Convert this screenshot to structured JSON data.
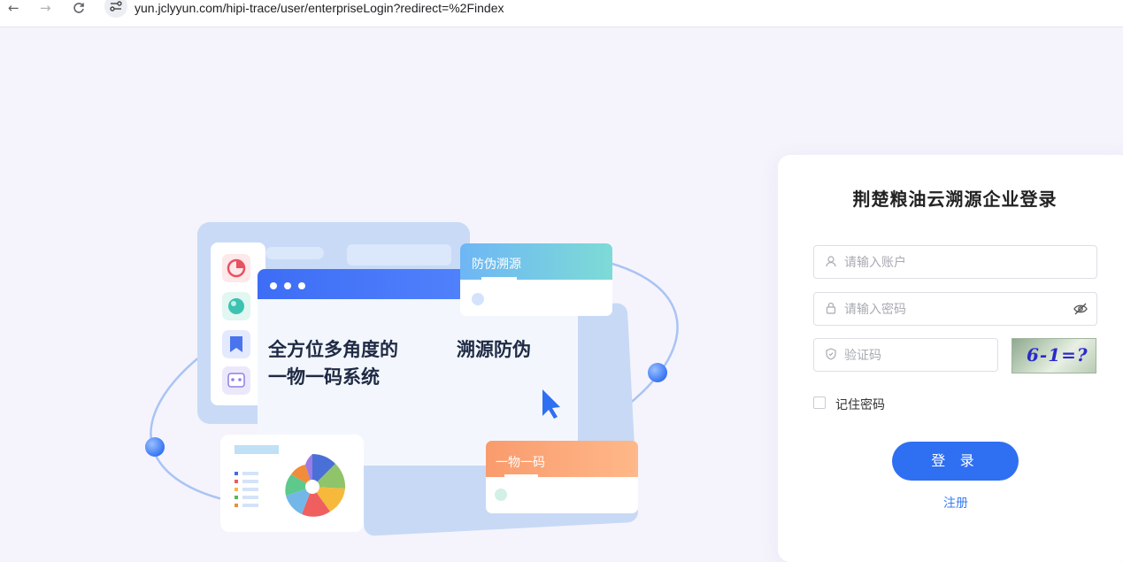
{
  "browser": {
    "back": "←",
    "forward": "→",
    "reload": "C",
    "site_icon": "⚲",
    "url": "yun.jclyyun.com/hipi-trace/user/enterpriseLogin?redirect=%2Findex"
  },
  "illustration": {
    "headline_line1": "全方位多角度的",
    "headline_line2": "一物一码系统",
    "headline_right": "溯源防伪",
    "tag_top": "防伪溯源",
    "tag_bottom": "一物一码",
    "dots": "•••"
  },
  "login": {
    "title": "荆楚粮油云溯源企业登录",
    "account_placeholder": "请输入账户",
    "password_placeholder": "请输入密码",
    "captcha_placeholder": "验证码",
    "captcha_text": "6-1=?",
    "remember_label": "记住密码",
    "login_button": "登 录",
    "register_link": "注册"
  },
  "colors": {
    "accent": "#2f6ff2",
    "background": "#f5f4fc",
    "link": "#3a7ef3"
  }
}
